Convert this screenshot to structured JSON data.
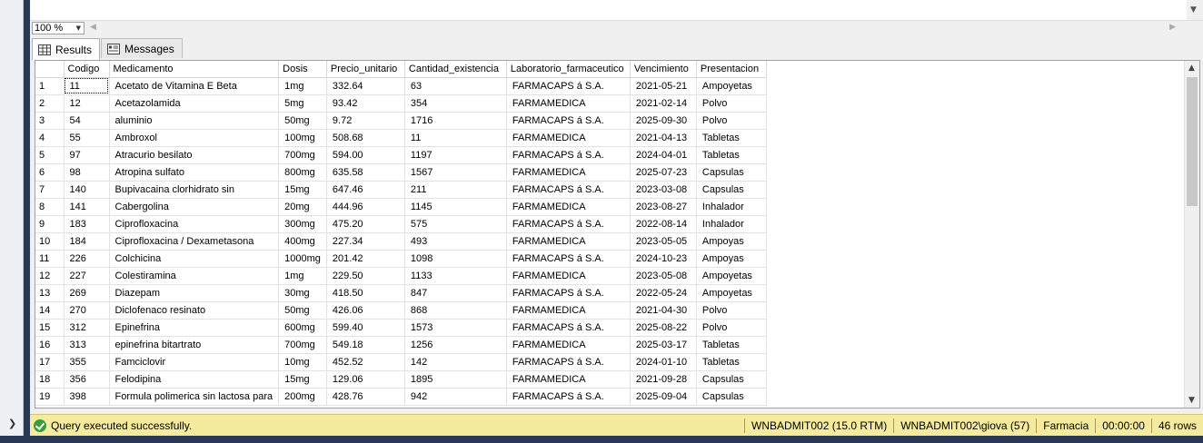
{
  "editor": {
    "content": ""
  },
  "zoom": {
    "value": "100 %"
  },
  "tabs": [
    {
      "label": "Results",
      "icon": "grid-icon",
      "active": true
    },
    {
      "label": "Messages",
      "icon": "messages-icon",
      "active": false
    }
  ],
  "grid": {
    "columns": [
      "",
      "Codigo",
      "Medicamento",
      "Dosis",
      "Precio_unitario",
      "Cantidad_existencia",
      "Laboratorio_farmaceutico",
      "Vencimiento",
      "Presentacion"
    ],
    "rows": [
      [
        "1",
        "11",
        "Acetato de Vitamina E Beta",
        "1mg",
        "332.64",
        "63",
        "FARMACAPS á S.A.",
        "2021-05-21",
        "Ampoyetas"
      ],
      [
        "2",
        "12",
        "Acetazolamida",
        "5mg",
        "93.42",
        "354",
        "FARMAMEDICA",
        "2021-02-14",
        "Polvo"
      ],
      [
        "3",
        "54",
        "aluminio",
        "50mg",
        "9.72",
        "1716",
        "FARMACAPS á S.A.",
        "2025-09-30",
        "Polvo"
      ],
      [
        "4",
        "55",
        "Ambroxol",
        "100mg",
        "508.68",
        "11",
        "FARMAMEDICA",
        "2021-04-13",
        "Tabletas"
      ],
      [
        "5",
        "97",
        "Atracurio besilato",
        "700mg",
        "594.00",
        "1197",
        "FARMACAPS á S.A.",
        "2024-04-01",
        "Tabletas"
      ],
      [
        "6",
        "98",
        "Atropina sulfato",
        "800mg",
        "635.58",
        "1567",
        "FARMAMEDICA",
        "2025-07-23",
        "Capsulas"
      ],
      [
        "7",
        "140",
        "Bupivacaina clorhidrato sin",
        "15mg",
        "647.46",
        "211",
        "FARMACAPS á S.A.",
        "2023-03-08",
        "Capsulas"
      ],
      [
        "8",
        "141",
        "Cabergolina",
        "20mg",
        "444.96",
        "1145",
        "FARMAMEDICA",
        "2023-08-27",
        "Inhalador"
      ],
      [
        "9",
        "183",
        "Ciprofloxacina",
        "300mg",
        "475.20",
        "575",
        "FARMACAPS á S.A.",
        "2022-08-14",
        "Inhalador"
      ],
      [
        "10",
        "184",
        "Ciprofloxacina / Dexametasona",
        "400mg",
        "227.34",
        "493",
        "FARMAMEDICA",
        "2023-05-05",
        "Ampoyas"
      ],
      [
        "11",
        "226",
        "Colchicina",
        "1000mg",
        "201.42",
        "1098",
        "FARMACAPS á S.A.",
        "2024-10-23",
        "Ampoyas"
      ],
      [
        "12",
        "227",
        "Colestiramina",
        "1mg",
        "229.50",
        "1133",
        "FARMAMEDICA",
        "2023-05-08",
        "Ampoyetas"
      ],
      [
        "13",
        "269",
        "Diazepam",
        "30mg",
        "418.50",
        "847",
        "FARMACAPS á S.A.",
        "2022-05-24",
        "Ampoyetas"
      ],
      [
        "14",
        "270",
        "Diclofenaco resinato",
        "50mg",
        "426.06",
        "868",
        "FARMAMEDICA",
        "2021-04-30",
        "Polvo"
      ],
      [
        "15",
        "312",
        "Epinefrina",
        "600mg",
        "599.40",
        "1573",
        "FARMACAPS á S.A.",
        "2025-08-22",
        "Polvo"
      ],
      [
        "16",
        "313",
        "epinefrina bitartrato",
        "700mg",
        "549.18",
        "1256",
        "FARMAMEDICA",
        "2025-03-17",
        "Tabletas"
      ],
      [
        "17",
        "355",
        "Famciclovir",
        "10mg",
        "452.52",
        "142",
        "FARMACAPS á S.A.",
        "2024-01-10",
        "Tabletas"
      ],
      [
        "18",
        "356",
        "Felodipina",
        "15mg",
        "129.06",
        "1895",
        "FARMAMEDICA",
        "2021-09-28",
        "Capsulas"
      ],
      [
        "19",
        "398",
        "Formula polimerica sin lactosa para",
        "200mg",
        "428.76",
        "942",
        "FARMACAPS á S.A.",
        "2025-09-04",
        "Capsulas"
      ]
    ]
  },
  "status": {
    "message": "Query executed successfully.",
    "server": "WNBADMIT002 (15.0 RTM)",
    "user": "WNBADMIT002\\giova (57)",
    "database": "Farmacia",
    "elapsed": "00:00:00",
    "rows": "46 rows",
    "color": "#f5eb9e"
  }
}
